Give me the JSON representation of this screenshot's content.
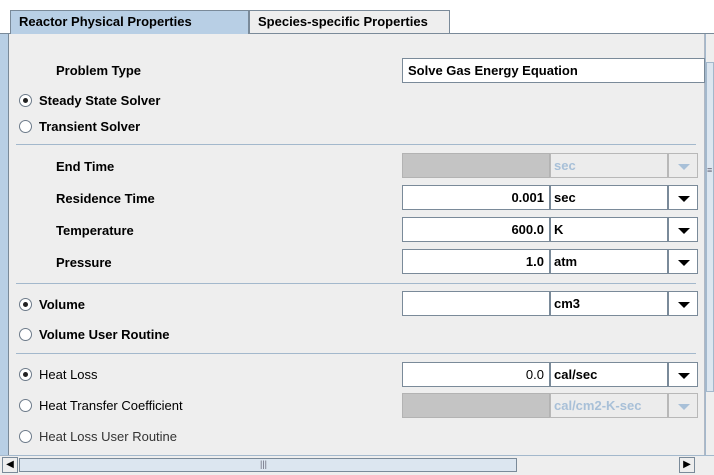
{
  "tabs": [
    {
      "label": "Reactor Physical Properties",
      "active": true
    },
    {
      "label": "Species-specific Properties",
      "active": false
    }
  ],
  "problem_type": {
    "label": "Problem Type",
    "value": "Solve Gas Energy Equation"
  },
  "solver": {
    "steady_label": "Steady State Solver",
    "transient_label": "Transient Solver",
    "selected": "steady"
  },
  "rows": {
    "end_time": {
      "label": "End Time",
      "value": "",
      "unit": "sec",
      "enabled": false
    },
    "residence_time": {
      "label": "Residence Time",
      "value": "0.001",
      "unit": "sec",
      "enabled": true
    },
    "temperature": {
      "label": "Temperature",
      "value": "600.0",
      "unit": "K",
      "enabled": true
    },
    "pressure": {
      "label": "Pressure",
      "value": "1.0",
      "unit": "atm",
      "enabled": true
    }
  },
  "volume": {
    "volume_label": "Volume",
    "value": "",
    "unit": "cm3",
    "user_routine_label": "Volume User Routine",
    "selected": "volume"
  },
  "heat": {
    "heat_loss_label": "Heat Loss",
    "heat_loss_value": "0.0",
    "heat_loss_unit": "cal/sec",
    "htc_label": "Heat Transfer Coefficient",
    "htc_unit": "cal/cm2-K-sec",
    "user_routine_label": "Heat Loss User Routine",
    "selected": "heat_loss"
  },
  "scrollbar_grip": "|||",
  "colors": {
    "tab_active": "#b8cfe5",
    "panel": "#eeeeee",
    "disabled_text": "#a8c0d8"
  }
}
